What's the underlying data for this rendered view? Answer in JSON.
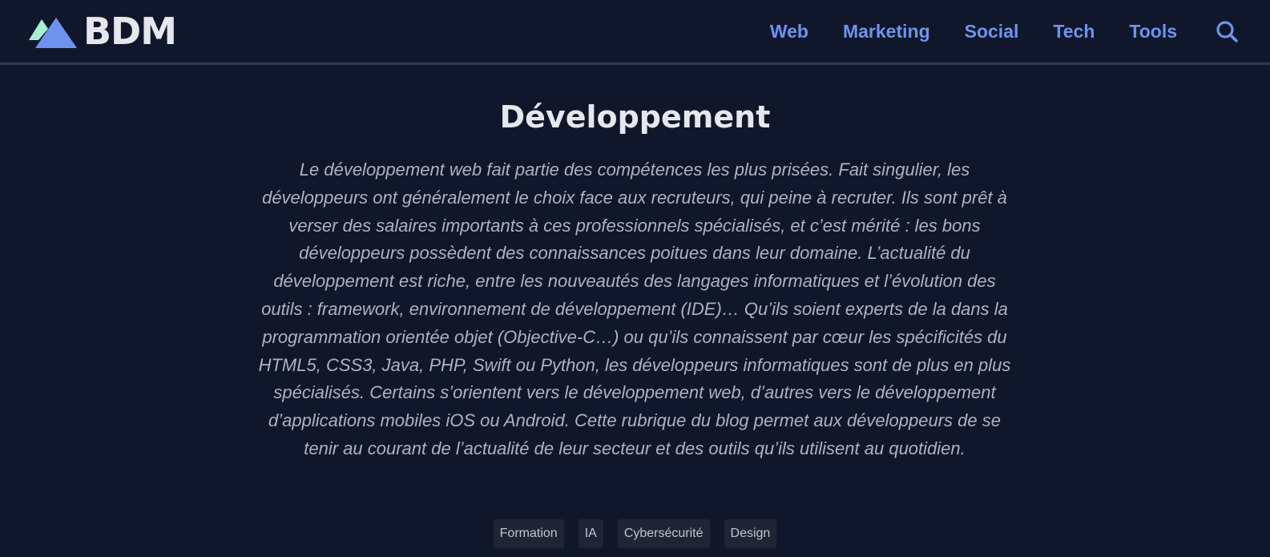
{
  "brand": {
    "name": "BDM",
    "mark_icon": "bdm-triangles-logo",
    "colors": {
      "mint": "#a8f0d2",
      "blue": "#6e93ee"
    }
  },
  "nav": {
    "items": [
      {
        "label": "Web"
      },
      {
        "label": "Marketing"
      },
      {
        "label": "Social"
      },
      {
        "label": "Tech"
      },
      {
        "label": "Tools"
      }
    ],
    "search_icon": "search-icon"
  },
  "main": {
    "title": "Développement",
    "description": "Le développement web fait partie des compétences les plus prisées. Fait singulier, les développeurs ont généralement le choix face aux recruteurs, qui peine à recruter. Ils sont prêt à verser des salaires importants à ces professionnels spécialisés, et c’est mérité : les bons développeurs possèdent des connaissances poitues dans leur domaine. L’actualité du développement est riche, entre les nouveautés des langages informatiques et l’évolution des outils : framework, environnement de développement (IDE)… Qu’ils soient experts de la dans la programmation orientée objet (Objective-C…) ou qu’ils connaissent par cœur les spécificités du HTML5, CSS3, Java, PHP, Swift ou Python, les développeurs informatiques sont de plus en plus spécialisés. Certains s’orientent vers le développement web, d’autres vers le développement d’applications mobiles iOS ou Android. Cette rubrique du blog permet aux développeurs de se tenir au courant de l’actualité de leur secteur et des outils qu’ils utilisent au quotidien.",
    "tags": [
      {
        "label": "Formation"
      },
      {
        "label": "IA"
      },
      {
        "label": "Cybersécurité"
      },
      {
        "label": "Design"
      }
    ]
  },
  "theme": {
    "background": "#11172a",
    "accent": "#6e93ee",
    "text": "#e6e7ec",
    "muted_text": "#aeb2bf",
    "tag_background": "#1f2535"
  }
}
